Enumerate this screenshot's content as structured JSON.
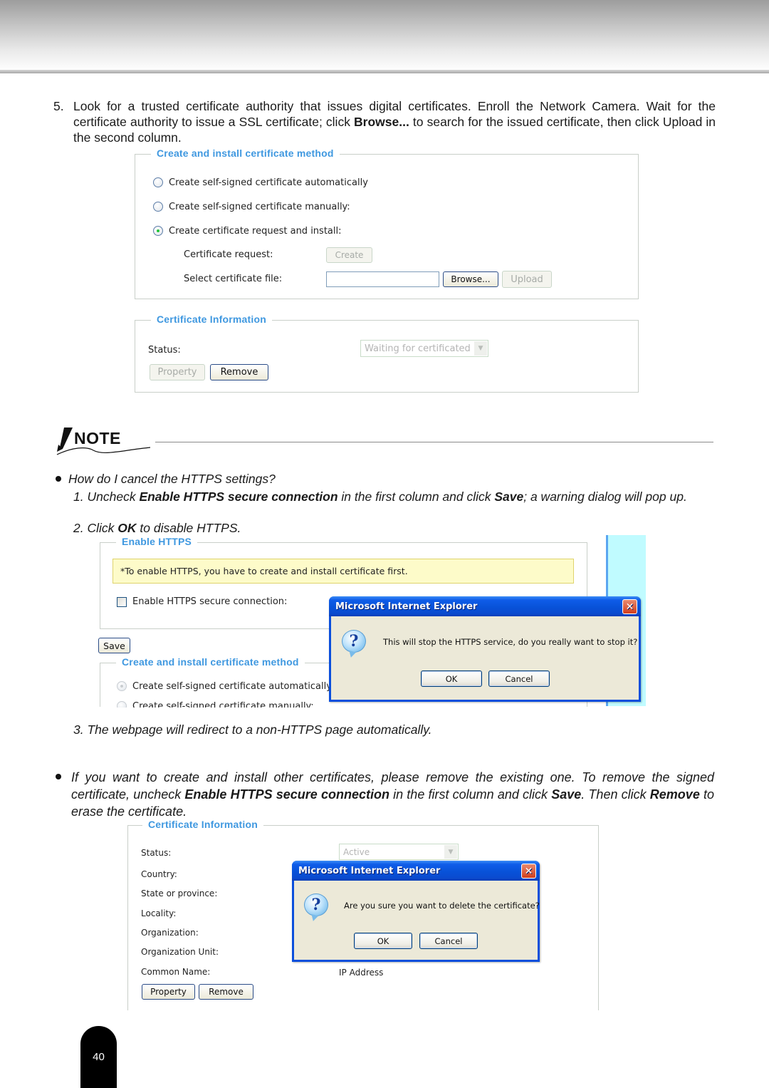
{
  "step5": {
    "number": "5.",
    "text_pre": "Look for a trusted certificate authority that issues digital certificates. Enroll the Network Camera. Wait for the certificate authority to issue a SSL certificate; click ",
    "text_bold": "Browse...",
    "text_post": " to search for the issued certificate, then click Upload in the second column."
  },
  "screenshot1": {
    "method_fieldset": {
      "legend": "Create and install certificate method",
      "options": [
        {
          "label": "Create self-signed certificate automatically",
          "checked": false
        },
        {
          "label": "Create self-signed certificate manually:",
          "checked": false
        },
        {
          "label": "Create certificate request and install:",
          "checked": true
        }
      ],
      "certificate_request_label": "Certificate request:",
      "create_button": "Create",
      "select_file_label": "Select certificate file:",
      "file_input_value": "",
      "browse_button": "Browse...",
      "upload_button": "Upload"
    },
    "info_fieldset": {
      "legend": "Certificate Information",
      "status_label": "Status:",
      "status_value": "Waiting for certificated",
      "property_button": "Property",
      "remove_button": "Remove"
    }
  },
  "note": {
    "heading": "NOTE",
    "q1": "How do I cancel the HTTPS settings?",
    "q1_steps": {
      "s1_num": "1.",
      "s1_a": "Uncheck ",
      "s1_b": "Enable HTTPS secure connection",
      "s1_c": " in the first column and click ",
      "s1_d": "Save",
      "s1_e": "; a warning dialog will pop up.",
      "s2_num": "2.",
      "s2_a": "Click ",
      "s2_b": "OK",
      "s2_c": " to disable HTTPS.",
      "s3": "3. The webpage will redirect to a non-HTTPS page automatically."
    },
    "q2_a": "If you want to create and install other certificates, please remove the existing one. To remove the signed certificate, uncheck ",
    "q2_b": "Enable HTTPS secure connection",
    "q2_c": " in the first column and click ",
    "q2_d": "Save",
    "q2_e": ". Then click ",
    "q2_f": "Remove",
    "q2_g": " to erase the certificate."
  },
  "screenshot2": {
    "enable_fieldset": {
      "legend": "Enable HTTPS",
      "notice": "*To enable HTTPS, you have to create and install certificate first.",
      "checkbox_label": "Enable HTTPS secure connection:",
      "checked": false
    },
    "save_button": "Save",
    "method_legend": "Create and install certificate method",
    "options": [
      "Create self-signed certificate automatically",
      "Create self-signed certificate manually:"
    ],
    "dialog": {
      "title": "Microsoft Internet Explorer",
      "close": "✕",
      "icon": "question-icon",
      "message": "This will stop the HTTPS service, do you really want to stop it?",
      "ok": "OK",
      "cancel": "Cancel"
    }
  },
  "screenshot3": {
    "legend": "Certificate Information",
    "status_label": "Status:",
    "status_value": "Active",
    "fields": [
      "Country:",
      "State or province:",
      "Locality:",
      "Organization:",
      "Organization Unit:",
      "Common Name:"
    ],
    "common_name_value": "IP Address",
    "property_button": "Property",
    "remove_button": "Remove",
    "dialog": {
      "title": "Microsoft Internet Explorer",
      "close": "✕",
      "icon": "question-icon",
      "message": "Are you sure you want to delete the certificate?",
      "ok": "OK",
      "cancel": "Cancel"
    }
  },
  "page_number": "40",
  "colors": {
    "legend_blue": "#3f98e0",
    "xp_title_blue": "#0852d8",
    "xp_dialog_bg": "#ece9d8",
    "notice_yellow": "#fdfbc9",
    "page_tab": "#000000"
  }
}
